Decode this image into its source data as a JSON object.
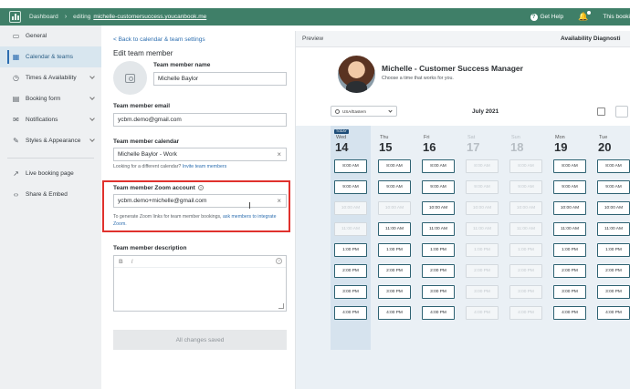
{
  "topbar": {
    "crumb": "Dashboard",
    "editing": "editing",
    "editing_link": "michelle-customersuccess.youcanbook.me",
    "help": "Get Help",
    "bookings": "This booki"
  },
  "sidebar": {
    "items": [
      {
        "label": "General",
        "icon": "window-icon",
        "active": false
      },
      {
        "label": "Calendar & teams",
        "icon": "calendar-icon",
        "active": true
      },
      {
        "label": "Times & Availability",
        "icon": "clock-icon",
        "active": false,
        "chevron": true
      },
      {
        "label": "Booking form",
        "icon": "form-icon",
        "active": false,
        "chevron": true
      },
      {
        "label": "Notifications",
        "icon": "envelope-icon",
        "active": false,
        "chevron": true
      },
      {
        "label": "Styles & Appearance",
        "icon": "palette-icon",
        "active": false,
        "chevron": true
      }
    ],
    "links": [
      {
        "label": "Live booking page",
        "icon": "external-link-icon"
      },
      {
        "label": "Share & Embed",
        "icon": "code-icon"
      }
    ]
  },
  "form": {
    "back": "< Back to calendar & team settings",
    "title": "Edit team member",
    "name_label": "Team member name",
    "name_value": "Michelle Baylor",
    "email_label": "Team member email",
    "email_value": "ycbm.demo@gmail.com",
    "calendar_label": "Team member calendar",
    "calendar_value": "Michelle Baylor - Work",
    "calendar_help_prefix": "Looking for a different calendar?",
    "calendar_help_link": "Invite team members",
    "zoom_label": "Team member Zoom account",
    "zoom_value": "ycbm.demo+michelle@gmail.com",
    "zoom_help_prefix": "To generate Zoom links for team member bookings,",
    "zoom_help_link": "ask members to integrate Zoom.",
    "desc_label": "Team member description",
    "save": "All changes saved"
  },
  "preview": {
    "label": "Preview",
    "availability": "Availability Diagnosti",
    "host_name": "Michelle - Customer Success Manager",
    "host_sub": "Choose a time that works for you.",
    "timezone": "USA/Eastern",
    "month": "July 2021",
    "today_badge": "TODAY",
    "days": [
      {
        "name": "Wed",
        "num": "14",
        "today": true,
        "past": false,
        "slots": [
          [
            "8:00 AM",
            true
          ],
          [
            "9:00 AM",
            true
          ],
          [
            "10:00 AM",
            false
          ],
          [
            "11:00 AM",
            false
          ],
          [
            "1:00 PM",
            true
          ],
          [
            "2:00 PM",
            true
          ],
          [
            "3:00 PM",
            true
          ],
          [
            "4:00 PM",
            true
          ]
        ]
      },
      {
        "name": "Thu",
        "num": "15",
        "today": false,
        "past": false,
        "slots": [
          [
            "8:00 AM",
            true
          ],
          [
            "9:00 AM",
            true
          ],
          [
            "10:00 AM",
            false
          ],
          [
            "11:00 AM",
            true
          ],
          [
            "1:00 PM",
            true
          ],
          [
            "2:00 PM",
            true
          ],
          [
            "3:00 PM",
            true
          ],
          [
            "4:00 PM",
            true
          ]
        ]
      },
      {
        "name": "Fri",
        "num": "16",
        "today": false,
        "past": false,
        "slots": [
          [
            "8:00 AM",
            true
          ],
          [
            "9:00 AM",
            true
          ],
          [
            "10:00 AM",
            true
          ],
          [
            "11:00 AM",
            true
          ],
          [
            "1:00 PM",
            true
          ],
          [
            "2:00 PM",
            true
          ],
          [
            "3:00 PM",
            true
          ],
          [
            "4:00 PM",
            true
          ]
        ]
      },
      {
        "name": "Sat",
        "num": "17",
        "today": false,
        "past": true,
        "slots": [
          [
            "8:00 AM",
            false
          ],
          [
            "9:00 AM",
            false
          ],
          [
            "10:00 AM",
            false
          ],
          [
            "11:00 AM",
            false
          ],
          [
            "1:00 PM",
            false
          ],
          [
            "2:00 PM",
            false
          ],
          [
            "3:00 PM",
            false
          ],
          [
            "4:00 PM",
            false
          ]
        ]
      },
      {
        "name": "Sun",
        "num": "18",
        "today": false,
        "past": true,
        "slots": [
          [
            "8:00 AM",
            false
          ],
          [
            "9:00 AM",
            false
          ],
          [
            "10:00 AM",
            false
          ],
          [
            "11:00 AM",
            false
          ],
          [
            "1:00 PM",
            false
          ],
          [
            "2:00 PM",
            false
          ],
          [
            "3:00 PM",
            false
          ],
          [
            "4:00 PM",
            false
          ]
        ]
      },
      {
        "name": "Mon",
        "num": "19",
        "today": false,
        "past": false,
        "slots": [
          [
            "8:00 AM",
            true
          ],
          [
            "9:00 AM",
            true
          ],
          [
            "10:00 AM",
            true
          ],
          [
            "11:00 AM",
            true
          ],
          [
            "1:00 PM",
            true
          ],
          [
            "2:00 PM",
            true
          ],
          [
            "3:00 PM",
            true
          ],
          [
            "4:00 PM",
            true
          ]
        ]
      },
      {
        "name": "Tue",
        "num": "20",
        "today": false,
        "past": false,
        "slots": [
          [
            "8:00 AM",
            true
          ],
          [
            "9:00 AM",
            true
          ],
          [
            "10:00 AM",
            true
          ],
          [
            "11:00 AM",
            true
          ],
          [
            "1:00 PM",
            true
          ],
          [
            "2:00 PM",
            true
          ],
          [
            "3:00 PM",
            true
          ],
          [
            "4:00 PM",
            true
          ]
        ]
      }
    ]
  }
}
